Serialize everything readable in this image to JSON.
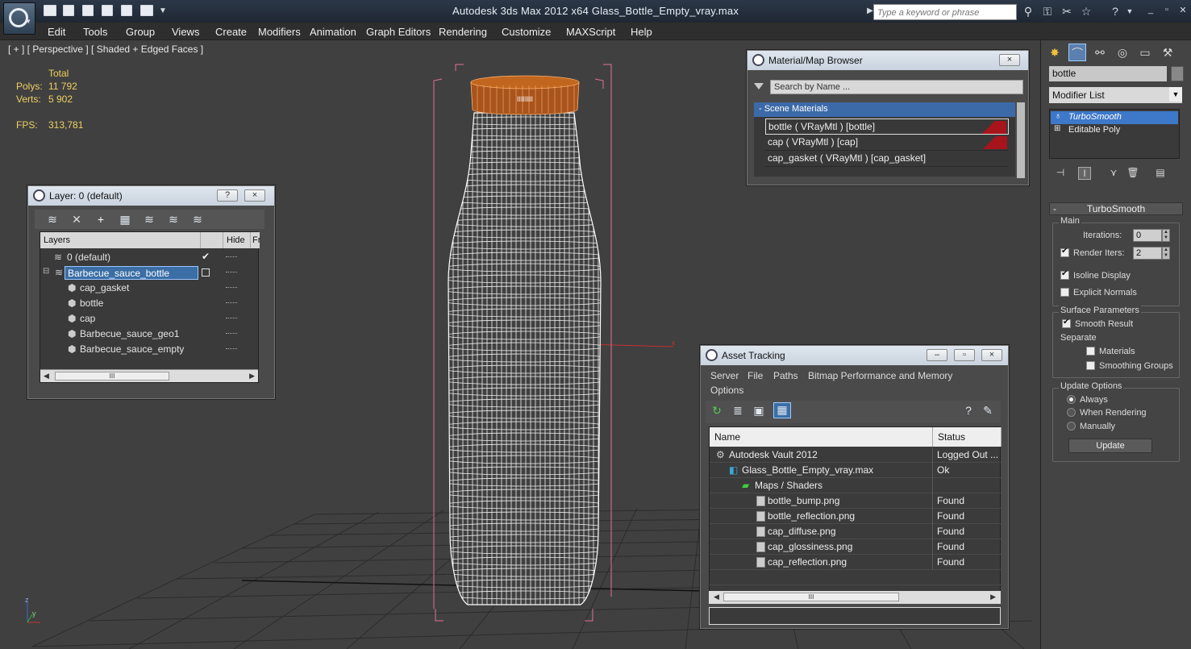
{
  "window": {
    "title": "Autodesk 3ds Max  2012 x64     Glass_Bottle_Empty_vray.max",
    "search_placeholder": "Type a keyword or phrase"
  },
  "menu": [
    "Edit",
    "Tools",
    "Group",
    "Views",
    "Create",
    "Modifiers",
    "Animation",
    "Graph Editors",
    "Rendering",
    "Customize",
    "MAXScript",
    "Help"
  ],
  "viewport": {
    "label": "[ + ] [ Perspective ] [ Shaded + Edged Faces ]",
    "stats": {
      "total_label": "Total",
      "polys_label": "Polys:",
      "polys_value": "11 792",
      "verts_label": "Verts:",
      "verts_value": "5 902",
      "fps_label": "FPS:",
      "fps_value": "313,781"
    },
    "axis_labels": {
      "x": "x",
      "y": "y",
      "z": "z"
    }
  },
  "layer_panel": {
    "title": "Layer: 0 (default)",
    "help_btn": "?",
    "close_btn": "×",
    "columns": {
      "layers": "Layers",
      "hide": "Hide",
      "freeze": "Fr"
    },
    "rows": [
      {
        "name": "0 (default)",
        "checked": true
      },
      {
        "name": "Barbecue_sauce_bottle",
        "selected": true
      },
      {
        "name": "cap_gasket"
      },
      {
        "name": "bottle"
      },
      {
        "name": "cap"
      },
      {
        "name": "Barbecue_sauce_geo1"
      },
      {
        "name": "Barbecue_sauce_empty"
      }
    ],
    "scroll_mark": "III"
  },
  "material_browser": {
    "title": "Material/Map Browser",
    "close_btn": "×",
    "search_placeholder": "Search by Name ...",
    "section": "- Scene Materials",
    "materials": [
      {
        "label": "bottle  ( VRayMtl )  [bottle]",
        "swatch": true
      },
      {
        "label": "cap  ( VRayMtl )  [cap]",
        "swatch": true
      },
      {
        "label": "cap_gasket  ( VRayMtl )  [cap_gasket]",
        "swatch": false
      }
    ],
    "swatch_color": "#a8141c"
  },
  "asset_tracking": {
    "title": "Asset Tracking",
    "menu": [
      "Server",
      "File",
      "Paths",
      "Bitmap Performance and Memory",
      "Options"
    ],
    "columns": {
      "name": "Name",
      "status": "Status"
    },
    "rows": [
      {
        "name": "Autodesk Vault 2012",
        "status": "Logged Out ..."
      },
      {
        "name": "Glass_Bottle_Empty_vray.max",
        "status": "Ok"
      },
      {
        "name": "Maps / Shaders",
        "status": ""
      },
      {
        "name": "bottle_bump.png",
        "status": "Found"
      },
      {
        "name": "bottle_reflection.png",
        "status": "Found"
      },
      {
        "name": "cap_diffuse.png",
        "status": "Found"
      },
      {
        "name": "cap_glossiness.png",
        "status": "Found"
      },
      {
        "name": "cap_reflection.png",
        "status": "Found"
      }
    ],
    "scroll_mark": "III"
  },
  "command_panel": {
    "object_name": "bottle",
    "modifier_list": "Modifier List",
    "stack": [
      "TurboSmooth",
      "Editable Poly"
    ],
    "rollout_title": "TurboSmooth",
    "main_group": "Main",
    "iterations_label": "Iterations:",
    "iterations_value": "0",
    "render_iters_label": "Render Iters:",
    "render_iters_value": "2",
    "isoline_label": "Isoline Display",
    "explicit_normals_label": "Explicit Normals",
    "surface_group": "Surface Parameters",
    "smooth_result_label": "Smooth Result",
    "separate_label": "Separate",
    "materials_label": "Materials",
    "smoothing_groups_label": "Smoothing Groups",
    "update_group": "Update Options",
    "always_label": "Always",
    "when_rendering_label": "When Rendering",
    "manually_label": "Manually",
    "update_button": "Update"
  }
}
